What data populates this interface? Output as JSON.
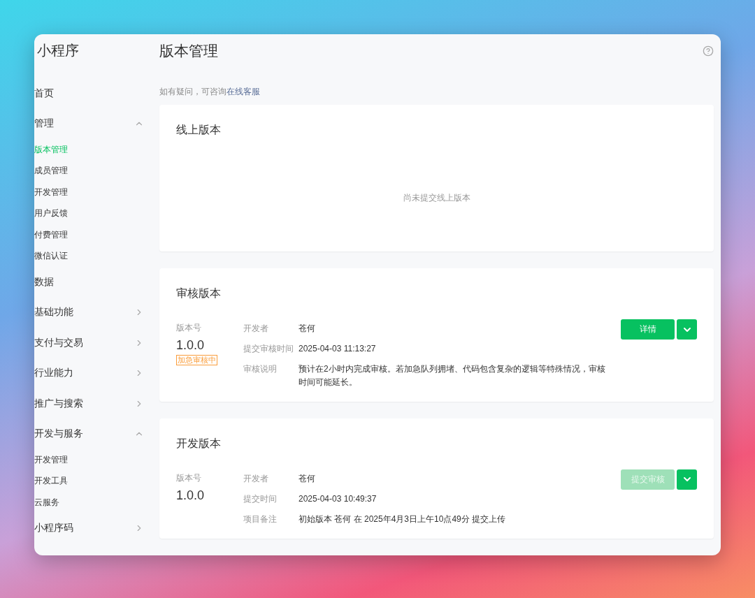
{
  "sidebar": {
    "title": "小程序",
    "items": [
      {
        "label": "首页",
        "kind": "link",
        "selected": false
      },
      {
        "label": "管理",
        "kind": "group",
        "expanded": true,
        "selected": false,
        "children": [
          {
            "label": "版本管理",
            "selected": true
          },
          {
            "label": "成员管理",
            "selected": false
          },
          {
            "label": "开发管理",
            "selected": false
          },
          {
            "label": "用户反馈",
            "selected": false
          },
          {
            "label": "付费管理",
            "selected": false
          },
          {
            "label": "微信认证",
            "selected": false
          }
        ]
      },
      {
        "label": "数据",
        "kind": "link",
        "selected": false
      },
      {
        "label": "基础功能",
        "kind": "group",
        "expanded": false,
        "selected": false
      },
      {
        "label": "支付与交易",
        "kind": "group",
        "expanded": false,
        "selected": false
      },
      {
        "label": "行业能力",
        "kind": "group",
        "expanded": false,
        "selected": false
      },
      {
        "label": "推广与搜索",
        "kind": "group",
        "expanded": false,
        "selected": false
      },
      {
        "label": "开发与服务",
        "kind": "group",
        "expanded": true,
        "selected": false,
        "children": [
          {
            "label": "开发管理",
            "selected": false
          },
          {
            "label": "开发工具",
            "selected": false
          },
          {
            "label": "云服务",
            "selected": false
          }
        ]
      },
      {
        "label": "小程序码",
        "kind": "group",
        "expanded": false,
        "selected": false
      }
    ]
  },
  "header": {
    "title": "版本管理",
    "hint": "如有疑问，可咨询",
    "hint_link": "在线客服"
  },
  "cards": [
    {
      "kind": "empty",
      "title": "线上版本",
      "message": "尚未提交线上版本"
    },
    {
      "kind": "detail",
      "title": "审核版本",
      "version_label": "版本号",
      "version": "1.0.0",
      "badge": "加急审核中",
      "fields": [
        {
          "label": "开发者",
          "value": "苍何"
        },
        {
          "label": "提交审核时间",
          "value": "2025-04-03 11:13:27"
        },
        {
          "label": "审核说明",
          "value": "预计在2小时内完成审核。若加急队列拥堵、代码包含复杂的逻辑等特殊情况，审核时间可能延长。"
        }
      ],
      "button": {
        "label": "详情",
        "disabled": false
      }
    },
    {
      "kind": "detail",
      "title": "开发版本",
      "version_label": "版本号",
      "version": "1.0.0",
      "fields": [
        {
          "label": "开发者",
          "value": "苍何"
        },
        {
          "label": "提交时间",
          "value": "2025-04-03 10:49:37"
        },
        {
          "label": "项目备注",
          "value": "初始版本 苍何 在 2025年4月3日上午10点49分 提交上传"
        }
      ],
      "button": {
        "label": "提交审核",
        "disabled": true
      }
    }
  ]
}
